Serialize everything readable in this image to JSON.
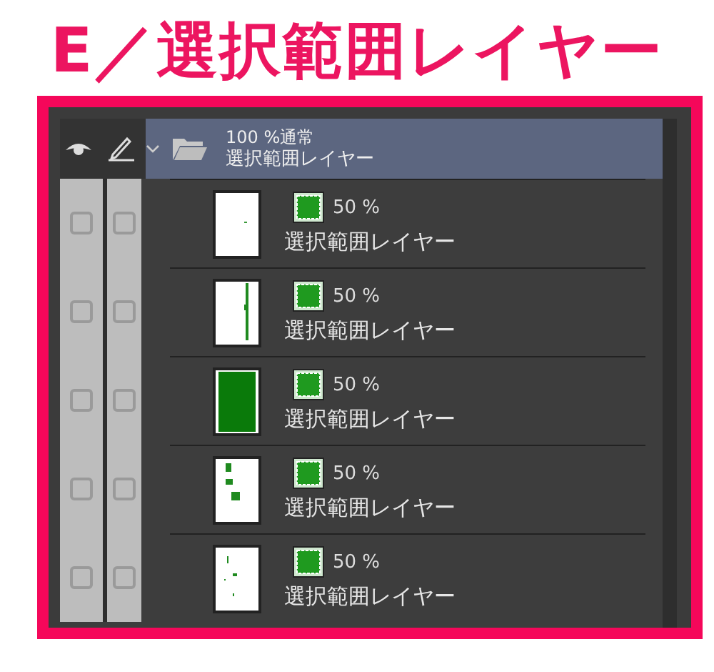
{
  "title": "E／選択範囲レイヤー",
  "folder": {
    "opacity_mode": "100 %通常",
    "name": "選択範囲レイヤー",
    "expanded": true,
    "selected": true
  },
  "layers": [
    {
      "kind": "speck",
      "opacity": "50 %",
      "name": "選択範囲レイヤー",
      "visible": false,
      "locked": false
    },
    {
      "kind": "line",
      "opacity": "50 %",
      "name": "選択範囲レイヤー",
      "visible": false,
      "locked": false
    },
    {
      "kind": "filled",
      "opacity": "50 %",
      "name": "選択範囲レイヤー",
      "visible": false,
      "locked": false
    },
    {
      "kind": "blotch",
      "opacity": "50 %",
      "name": "選択範囲レイヤー",
      "visible": false,
      "locked": false
    },
    {
      "kind": "dots",
      "opacity": "50 %",
      "name": "選択範囲レイヤー",
      "visible": false,
      "locked": false
    }
  ]
}
